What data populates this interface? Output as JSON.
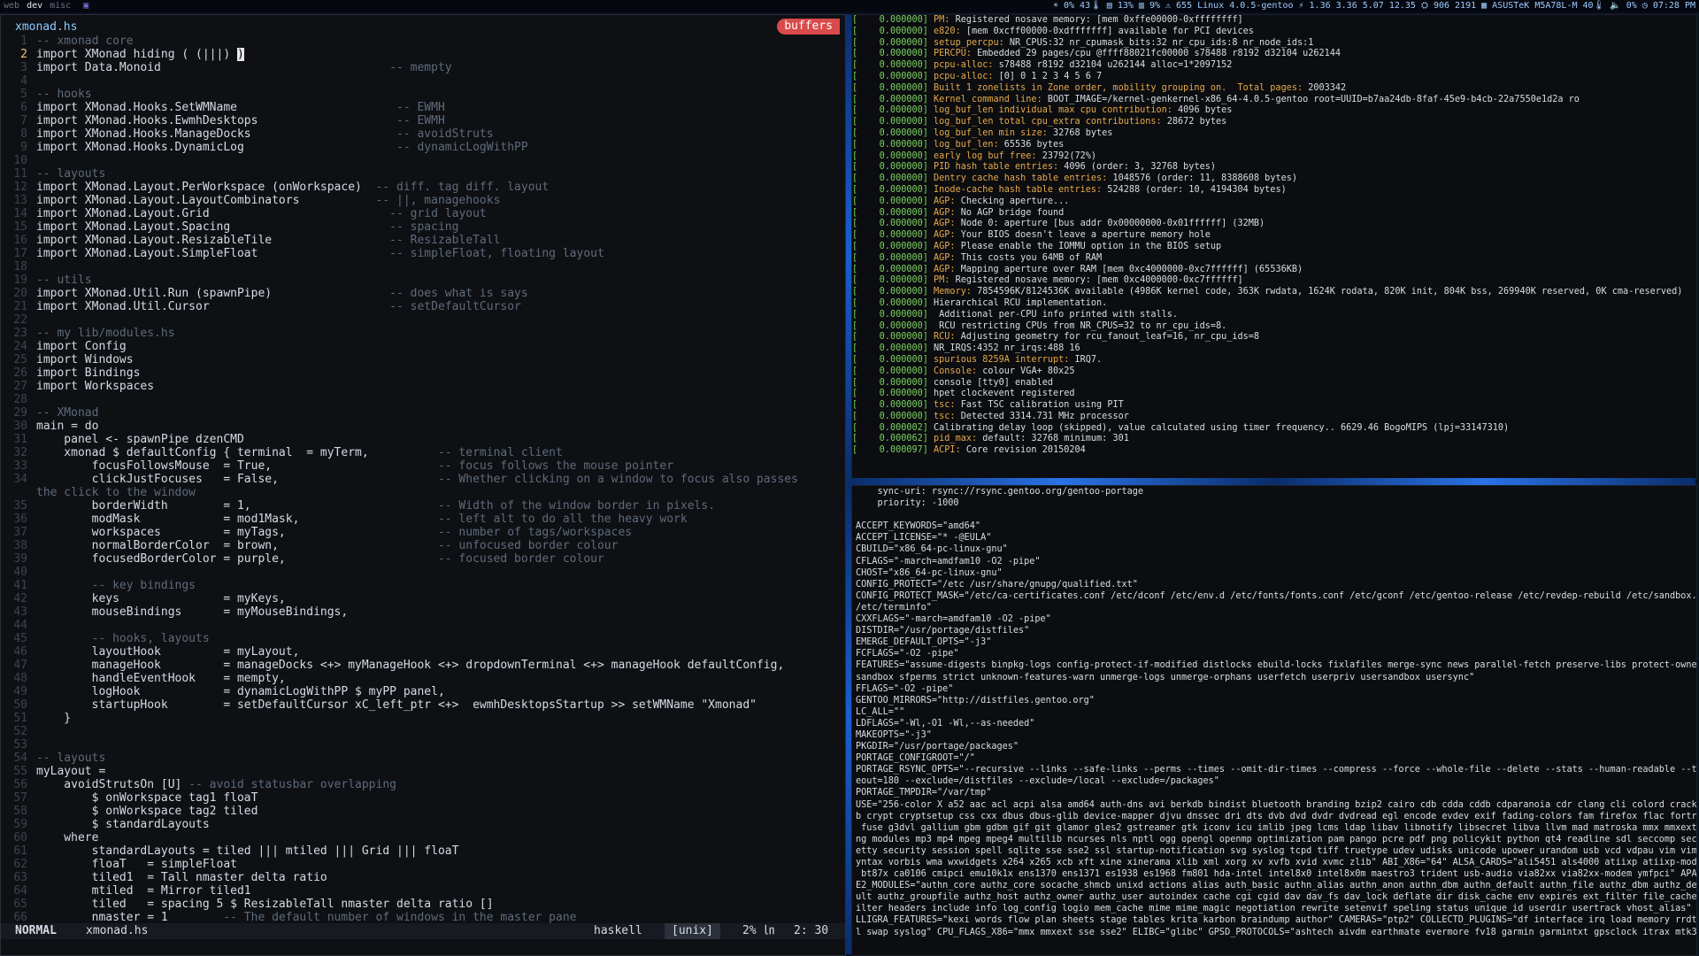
{
  "topbar": {
    "workspaces": [
      "web",
      "dev",
      "misc"
    ],
    "active_workspace": "dev",
    "marker": "▣",
    "status": [
      "☀ 0% 43🌡",
      "▤ 13%",
      "▥ 9%",
      "⚠ 655",
      "Linux 4.0.5-gentoo",
      "⚡ 1.36 3.36 5.07 12.35",
      "⛭ 906 2191",
      "▦ ASUSTeK M5A78L-M 40🌡",
      "🔈 0%",
      "◷ 07:28 PM"
    ]
  },
  "editor": {
    "filename": "xmonad.hs",
    "buffers_label": "buffers",
    "current_line": 2,
    "lines": [
      {
        "n": "1",
        "t": "-- xmonad core",
        "c": true
      },
      {
        "n": "2",
        "t": "import XMonad hiding ( (|||) ",
        "cursor": ")"
      },
      {
        "n": "3",
        "t": "import Data.Monoid                                 ",
        "com": "-- mempty"
      },
      {
        "n": "4",
        "t": ""
      },
      {
        "n": "5",
        "t": "-- hooks",
        "c": true
      },
      {
        "n": "6",
        "t": "import XMonad.Hooks.SetWMName                       ",
        "com": "-- EWMH"
      },
      {
        "n": "7",
        "t": "import XMonad.Hooks.EwmhDesktops                    ",
        "com": "-- EWMH"
      },
      {
        "n": "8",
        "t": "import XMonad.Hooks.ManageDocks                     ",
        "com": "-- avoidStruts"
      },
      {
        "n": "9",
        "t": "import XMonad.Hooks.DynamicLog                      ",
        "com": "-- dynamicLogWithPP"
      },
      {
        "n": "10",
        "t": ""
      },
      {
        "n": "11",
        "t": "-- layouts",
        "c": true
      },
      {
        "n": "12",
        "t": "import XMonad.Layout.PerWorkspace (onWorkspace)  ",
        "com": "-- diff. tag diff. layout"
      },
      {
        "n": "13",
        "t": "import XMonad.Layout.LayoutCombinators           ",
        "com": "-- ||, managehooks"
      },
      {
        "n": "14",
        "t": "import XMonad.Layout.Grid                          ",
        "com": "-- grid layout"
      },
      {
        "n": "15",
        "t": "import XMonad.Layout.Spacing                       ",
        "com": "-- spacing"
      },
      {
        "n": "16",
        "t": "import XMonad.Layout.ResizableTile                 ",
        "com": "-- ResizableTall"
      },
      {
        "n": "17",
        "t": "import XMonad.Layout.SimpleFloat                   ",
        "com": "-- simpleFloat, floating layout"
      },
      {
        "n": "18",
        "t": ""
      },
      {
        "n": "19",
        "t": "-- utils",
        "c": true
      },
      {
        "n": "20",
        "t": "import XMonad.Util.Run (spawnPipe)                 ",
        "com": "-- does what is says"
      },
      {
        "n": "21",
        "t": "import XMonad.Util.Cursor                          ",
        "com": "-- setDefaultCursor"
      },
      {
        "n": "22",
        "t": ""
      },
      {
        "n": "23",
        "t": "-- my lib/modules.hs",
        "c": true
      },
      {
        "n": "24",
        "t": "import Config"
      },
      {
        "n": "25",
        "t": "import Windows"
      },
      {
        "n": "26",
        "t": "import Bindings"
      },
      {
        "n": "27",
        "t": "import Workspaces"
      },
      {
        "n": "28",
        "t": ""
      },
      {
        "n": "29",
        "t": "-- XMonad",
        "c": true
      },
      {
        "n": "30",
        "t": "main = do"
      },
      {
        "n": "31",
        "t": "    panel <- spawnPipe dzenCMD"
      },
      {
        "n": "32",
        "t": "    xmonad $ defaultConfig { terminal  = myTerm,          ",
        "com": "-- terminal client"
      },
      {
        "n": "33",
        "t": "        focusFollowsMouse  = True,                        ",
        "com": "-- focus follows the mouse pointer"
      },
      {
        "n": "34",
        "t": "        clickJustFocuses   = False,                       ",
        "com": "-- Whether clicking on a window to focus also passes"
      },
      {
        "n": "",
        "t": "",
        "com": "the click to the window"
      },
      {
        "n": "35",
        "t": "        borderWidth        = 1,                           ",
        "com": "-- Width of the window border in pixels."
      },
      {
        "n": "36",
        "t": "        modMask            = mod1Mask,                    ",
        "com": "-- left alt to do all the heavy work"
      },
      {
        "n": "37",
        "t": "        workspaces         = myTags,                      ",
        "com": "-- number of tags/workspaces"
      },
      {
        "n": "38",
        "t": "        normalBorderColor  = brown,                       ",
        "com": "-- unfocused border colour"
      },
      {
        "n": "39",
        "t": "        focusedBorderColor = purple,                      ",
        "com": "-- focused border colour"
      },
      {
        "n": "40",
        "t": ""
      },
      {
        "n": "41",
        "t": "        -- key bindings",
        "c": true
      },
      {
        "n": "42",
        "t": "        keys               = myKeys,"
      },
      {
        "n": "43",
        "t": "        mouseBindings      = myMouseBindings,"
      },
      {
        "n": "44",
        "t": ""
      },
      {
        "n": "45",
        "t": "        -- hooks, layouts",
        "c": true
      },
      {
        "n": "46",
        "t": "        layoutHook         = myLayout,"
      },
      {
        "n": "47",
        "t": "        manageHook         = manageDocks <+> myManageHook <+> dropdownTerminal <+> manageHook defaultConfig,"
      },
      {
        "n": "48",
        "t": "        handleEventHook    = mempty,"
      },
      {
        "n": "49",
        "t": "        logHook            = dynamicLogWithPP $ myPP panel,"
      },
      {
        "n": "50",
        "t": "        startupHook        = setDefaultCursor xC_left_ptr <+>  ewmhDesktopsStartup >> setWMName \"Xmonad\""
      },
      {
        "n": "51",
        "t": "    }"
      },
      {
        "n": "52",
        "t": ""
      },
      {
        "n": "53",
        "t": ""
      },
      {
        "n": "54",
        "t": "-- layouts",
        "c": true
      },
      {
        "n": "55",
        "t": "myLayout ="
      },
      {
        "n": "56",
        "t": "    avoidStrutsOn [U] ",
        "com": "-- avoid statusbar overlapping"
      },
      {
        "n": "57",
        "t": "        $ onWorkspace tag1 floaT"
      },
      {
        "n": "58",
        "t": "        $ onWorkspace tag2 tiled"
      },
      {
        "n": "59",
        "t": "        $ standardLayouts"
      },
      {
        "n": "60",
        "t": "    where"
      },
      {
        "n": "61",
        "t": "        standardLayouts = tiled ||| mtiled ||| Grid ||| floaT"
      },
      {
        "n": "62",
        "t": "        floaT   = simpleFloat"
      },
      {
        "n": "63",
        "t": "        tiled1  = Tall nmaster delta ratio"
      },
      {
        "n": "64",
        "t": "        mtiled  = Mirror tiled1"
      },
      {
        "n": "65",
        "t": "        tiled   = spacing 5 $ ResizableTall nmaster delta ratio []"
      },
      {
        "n": "66",
        "t": "        nmaster = 1        ",
        "com": "-- The default number of windows in the master pane"
      }
    ],
    "status": {
      "mode": "NORMAL",
      "file": "xmonad.hs",
      "filetype": "haskell",
      "format": "[unix]",
      "percent": "2% ㏑",
      "position": "2: 30"
    }
  },
  "dmesg": [
    {
      "ts": "0.000000",
      "h": "PM:",
      "m": " Registered nosave memory: [mem 0xffe00000-0xffffffff]"
    },
    {
      "ts": "0.000000",
      "h": "e820:",
      "m": " [mem 0xcff00000-0xdfffffff] available for PCI devices"
    },
    {
      "ts": "0.000000",
      "h": "setup_percpu:",
      "m": " NR_CPUS:32 nr_cpumask_bits:32 nr_cpu_ids:8 nr_node_ids:1"
    },
    {
      "ts": "0.000000",
      "h": "PERCPU:",
      "m": " Embedded 29 pages/cpu @ffff88021fc00000 s78488 r8192 d32104 u262144"
    },
    {
      "ts": "0.000000",
      "h": "pcpu-alloc:",
      "m": " s78488 r8192 d32104 u262144 alloc=1*2097152"
    },
    {
      "ts": "0.000000",
      "h": "pcpu-alloc:",
      "m": " [0] 0 1 2 3 4 5 6 7"
    },
    {
      "ts": "0.000000",
      "h": "Built 1 zonelists in Zone order, mobility grouping on.  Total pages:",
      "m": " 2003342"
    },
    {
      "ts": "0.000000",
      "h": "Kernel command line:",
      "m": " BOOT_IMAGE=/kernel-genkernel-x86_64-4.0.5-gentoo root=UUID=b7aa24db-8faf-45e9-b4cb-22a7550e1d2a ro"
    },
    {
      "ts": "0.000000",
      "h": "log_buf_len individual max cpu contribution:",
      "m": " 4096 bytes"
    },
    {
      "ts": "0.000000",
      "h": "log_buf_len total cpu_extra contributions:",
      "m": " 28672 bytes"
    },
    {
      "ts": "0.000000",
      "h": "log_buf_len min size:",
      "m": " 32768 bytes"
    },
    {
      "ts": "0.000000",
      "h": "log_buf_len:",
      "m": " 65536 bytes"
    },
    {
      "ts": "0.000000",
      "h": "early log buf free:",
      "m": " 23792(72%)"
    },
    {
      "ts": "0.000000",
      "h": "PID hash table entries:",
      "m": " 4096 (order: 3, 32768 bytes)"
    },
    {
      "ts": "0.000000",
      "h": "Dentry cache hash table entries:",
      "m": " 1048576 (order: 11, 8388608 bytes)"
    },
    {
      "ts": "0.000000",
      "h": "Inode-cache hash table entries:",
      "m": " 524288 (order: 10, 4194304 bytes)"
    },
    {
      "ts": "0.000000",
      "h": "AGP:",
      "m": " Checking aperture..."
    },
    {
      "ts": "0.000000",
      "h": "AGP:",
      "m": " No AGP bridge found"
    },
    {
      "ts": "0.000000",
      "h": "AGP:",
      "m": " Node 0: aperture [bus addr 0x00000000-0x01ffffff] (32MB)"
    },
    {
      "ts": "0.000000",
      "h": "AGP:",
      "m": " Your BIOS doesn't leave a aperture memory hole"
    },
    {
      "ts": "0.000000",
      "h": "AGP:",
      "m": " Please enable the IOMMU option in the BIOS setup"
    },
    {
      "ts": "0.000000",
      "h": "AGP:",
      "m": " This costs you 64MB of RAM"
    },
    {
      "ts": "0.000000",
      "h": "AGP:",
      "m": " Mapping aperture over RAM [mem 0xc4000000-0xc7ffffff] (65536KB)"
    },
    {
      "ts": "0.000000",
      "h": "PM:",
      "m": " Registered nosave memory: [mem 0xc4000000-0xc7ffffff]"
    },
    {
      "ts": "0.000000",
      "h": "Memory:",
      "m": " 7854596K/8124536K available (4986K kernel code, 363K rwdata, 1624K rodata, 820K init, 804K bss, 269940K reserved, 0K cma-reserved)"
    },
    {
      "ts": "0.000000",
      "h": "",
      "m": "Hierarchical RCU implementation."
    },
    {
      "ts": "0.000000",
      "h": "",
      "m": " Additional per-CPU info printed with stalls."
    },
    {
      "ts": "0.000000",
      "h": "",
      "m": " RCU restricting CPUs from NR_CPUS=32 to nr_cpu_ids=8."
    },
    {
      "ts": "0.000000",
      "h": "RCU:",
      "m": " Adjusting geometry for rcu_fanout_leaf=16, nr_cpu_ids=8"
    },
    {
      "ts": "0.000000",
      "h": "",
      "m": "NR_IRQS:4352 nr_irqs:488 16"
    },
    {
      "ts": "0.000000",
      "h": "spurious 8259A interrupt:",
      "m": " IRQ7."
    },
    {
      "ts": "0.000000",
      "h": "Console:",
      "m": " colour VGA+ 80x25"
    },
    {
      "ts": "0.000000",
      "h": "",
      "m": "console [tty0] enabled"
    },
    {
      "ts": "0.000000",
      "h": "",
      "m": "hpet clockevent registered"
    },
    {
      "ts": "0.000000",
      "h": "tsc:",
      "m": " Fast TSC calibration using PIT"
    },
    {
      "ts": "0.000000",
      "h": "tsc:",
      "m": " Detected 3314.731 MHz processor"
    },
    {
      "ts": "0.000002",
      "h": "",
      "m": "Calibrating delay loop (skipped), value calculated using timer frequency.. 6629.46 BogoMIPS (lpj=33147310)"
    },
    {
      "ts": "0.000062",
      "h": "pid_max:",
      "m": " default: 32768 minimum: 301"
    },
    {
      "ts": "0.000097",
      "h": "ACPI:",
      "m": " Core revision 20150204"
    }
  ],
  "portage": [
    "    sync-uri: rsync://rsync.gentoo.org/gentoo-portage",
    "    priority: -1000",
    "",
    "ACCEPT_KEYWORDS=\"amd64\"",
    "ACCEPT_LICENSE=\"* -@EULA\"",
    "CBUILD=\"x86_64-pc-linux-gnu\"",
    "CFLAGS=\"-march=amdfam10 -O2 -pipe\"",
    "CHOST=\"x86_64-pc-linux-gnu\"",
    "CONFIG_PROTECT=\"/etc /usr/share/gnupg/qualified.txt\"",
    "CONFIG_PROTECT_MASK=\"/etc/ca-certificates.conf /etc/dconf /etc/env.d /etc/fonts/fonts.conf /etc/gconf /etc/gentoo-release /etc/revdep-rebuild /etc/sandbox.d",
    "/etc/terminfo\"",
    "CXXFLAGS=\"-march=amdfam10 -O2 -pipe\"",
    "DISTDIR=\"/usr/portage/distfiles\"",
    "EMERGE_DEFAULT_OPTS=\"-j3\"",
    "FCFLAGS=\"-O2 -pipe\"",
    "FEATURES=\"assume-digests binpkg-logs config-protect-if-modified distlocks ebuild-locks fixlafiles merge-sync news parallel-fetch preserve-libs protect-owned",
    "sandbox sfperms strict unknown-features-warn unmerge-logs unmerge-orphans userfetch userpriv usersandbox usersync\"",
    "FFLAGS=\"-O2 -pipe\"",
    "GENTOO_MIRRORS=\"http://distfiles.gentoo.org\"",
    "LC_ALL=\"\"",
    "LDFLAGS=\"-Wl,-O1 -Wl,--as-needed\"",
    "MAKEOPTS=\"-j3\"",
    "PKGDIR=\"/usr/portage/packages\"",
    "PORTAGE_CONFIGROOT=\"/\"",
    "PORTAGE_RSYNC_OPTS=\"--recursive --links --safe-links --perms --times --omit-dir-times --compress --force --whole-file --delete --stats --human-readable --tim",
    "eout=180 --exclude=/distfiles --exclude=/local --exclude=/packages\"",
    "PORTAGE_TMPDIR=\"/var/tmp\"",
    "USE=\"256-color X a52 aac acl acpi alsa amd64 auth-dns avi berkdb bindist bluetooth branding bzip2 cairo cdb cdda cddb cdparanoia cdr clang cli colord crackli",
    "b crypt cryptsetup css cxx dbus dbus-glib device-mapper djvu dnssec dri dts dvb dvd dvdr dvdread egl encode evdev exif fading-colors fam firefox flac fortran",
    " fuse g3dvl gallium gbm gdbm gif git glamor gles2 gstreamer gtk iconv icu imlib jpeg lcms ldap libav libnotify libsecret libva llvm mad matroska mmx mmxext m",
    "ng modules mp3 mp4 mpeg mpeg4 multilib ncurses nls nptl ogg opengl openmp optimization pam pango pcre pdf png policykit python qt4 readline sdl seccomp secur",
    "etty security session spell sqlite sse sse2 ssl startup-notification svg syslog tcpd tiff truetype udev udisks unicode upower urandom usb vcd vdpau vim vim-s",
    "yntax vorbis wma wxwidgets x264 x265 xcb xft xine xinerama xlib xml xorg xv xvfb xvid xvmc zlib\" ABI_X86=\"64\" ALSA_CARDS=\"ali5451 als4000 atiixp atiixp-modem",
    " bt87x ca0106 cmipci emu10k1x ens1370 ens1371 es1938 es1968 fm801 hda-intel intel8x0 intel8x0m maestro3 trident usb-audio via82xx via82xx-modem ymfpci\" APACH",
    "E2_MODULES=\"authn_core authz_core socache_shmcb unixd actions alias auth_basic authn_alias authn_anon authn_dbm authn_default authn_file authz_dbm authz_defa",
    "ult authz_groupfile authz_host authz_owner authz_user autoindex cache cgi cgid dav dav_fs dav_lock deflate dir disk_cache env expires ext_filter file_cache f",
    "ilter headers include info log_config logio mem_cache mime mime_magic negotiation rewrite setenvif speling status unique_id userdir usertrack vhost_alias\" CA",
    "LLIGRA_FEATURES=\"kexi words flow plan sheets stage tables krita karbon braindump author\" CAMERAS=\"ptp2\" COLLECTD_PLUGINS=\"df interface irq load memory rrdtoo",
    "l swap syslog\" CPU_FLAGS_X86=\"mmx mmxext sse sse2\" ELIBC=\"glibc\" GPSD_PROTOCOLS=\"ashtech aivdm earthmate evermore fv18 garmin garmintxt gpsclock itrax mtk330"
  ]
}
